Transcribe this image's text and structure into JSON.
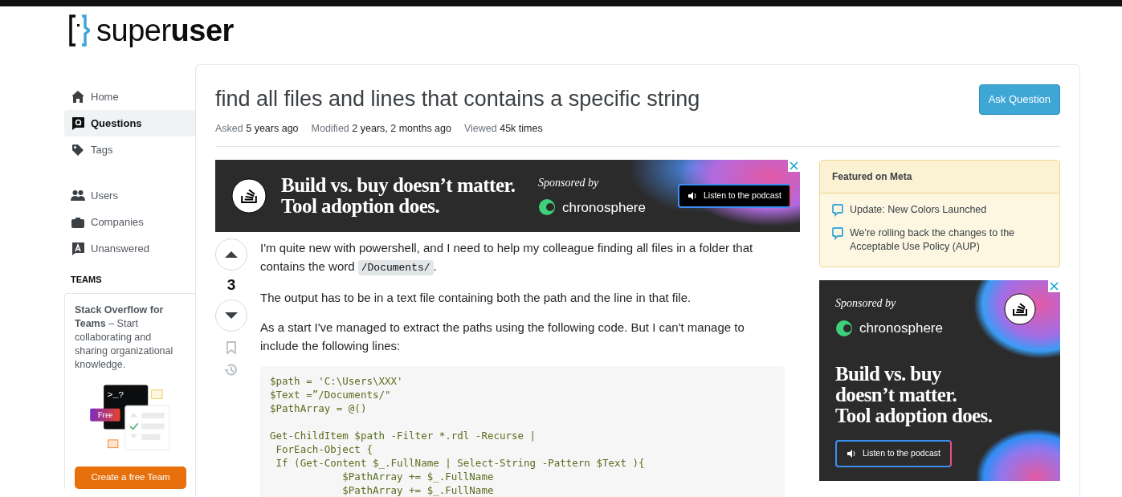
{
  "logo": {
    "light": "super",
    "bold": "user"
  },
  "sidebar": {
    "items": [
      {
        "label": "Home",
        "selected": false
      },
      {
        "label": "Questions",
        "selected": true
      },
      {
        "label": "Tags",
        "selected": false
      },
      {
        "label": "Users",
        "selected": false
      },
      {
        "label": "Companies",
        "selected": false
      },
      {
        "label": "Unanswered",
        "selected": false
      }
    ],
    "section_title": "TEAMS",
    "teams_card": {
      "text": "**Stack Overflow for Teams** – Start collaborating and sharing organizational knowledge.",
      "prompt": ">_?",
      "badge": "Free",
      "button": "Create a free Team"
    }
  },
  "question": {
    "title": "find all files and lines that contains a specific string",
    "ask_button": "Ask Question",
    "meta": [
      {
        "label": "Asked",
        "value": "5 years ago"
      },
      {
        "label": "Modified",
        "value": "2 years, 2 months ago"
      },
      {
        "label": "Viewed",
        "value": "45k times"
      }
    ],
    "votes": "3",
    "body": [
      {
        "kind": "paragraph",
        "segments": [
          {
            "kind": "text",
            "text": "I'm quite new with powershell, and I need to help my colleague finding all files in a folder that contains the word "
          },
          {
            "kind": "code",
            "text": "/Documents/"
          },
          {
            "kind": "text",
            "text": "."
          }
        ]
      },
      {
        "kind": "paragraph",
        "segments": [
          {
            "kind": "text",
            "text": "The output has to be in a text file containing both the path and the line in that file."
          }
        ]
      },
      {
        "kind": "paragraph",
        "segments": [
          {
            "kind": "text",
            "text": "As a start I've managed to extract the paths using the following code. But I can't manage to include the following lines:"
          }
        ]
      },
      {
        "kind": "code_block",
        "text": "$path = 'C:\\Users\\XXX'\n$Text =”/Documents/\"\n$PathArray = @()\n\nGet-ChildItem $path -Filter *.rdl -Recurse |\n ForEach-Object {\n If (Get-Content $_.FullName | Select-String -Pattern $Text ){\n            $PathArray += $_.FullName\n            $PathArray += $_.FullName"
      }
    ]
  },
  "ads": [
    {
      "kind": "banner",
      "headline": [
        "Build vs. buy doesn’t matter.",
        "Tool adoption does."
      ],
      "sponsored": "Sponsored by",
      "brand": "chronosphere",
      "cta": "Listen to the podcast"
    },
    {
      "kind": "box",
      "headline": [
        "Build vs. buy",
        "doesn’t matter.",
        "Tool adoption does."
      ],
      "sponsored": "Sponsored by",
      "brand": "chronosphere",
      "cta": "Listen to the podcast"
    }
  ],
  "featured": {
    "title": "Featured on Meta",
    "items": [
      "Update: New Colors Launched",
      "We're rolling back the changes to the Acceptable Use Policy (AUP)"
    ]
  }
}
